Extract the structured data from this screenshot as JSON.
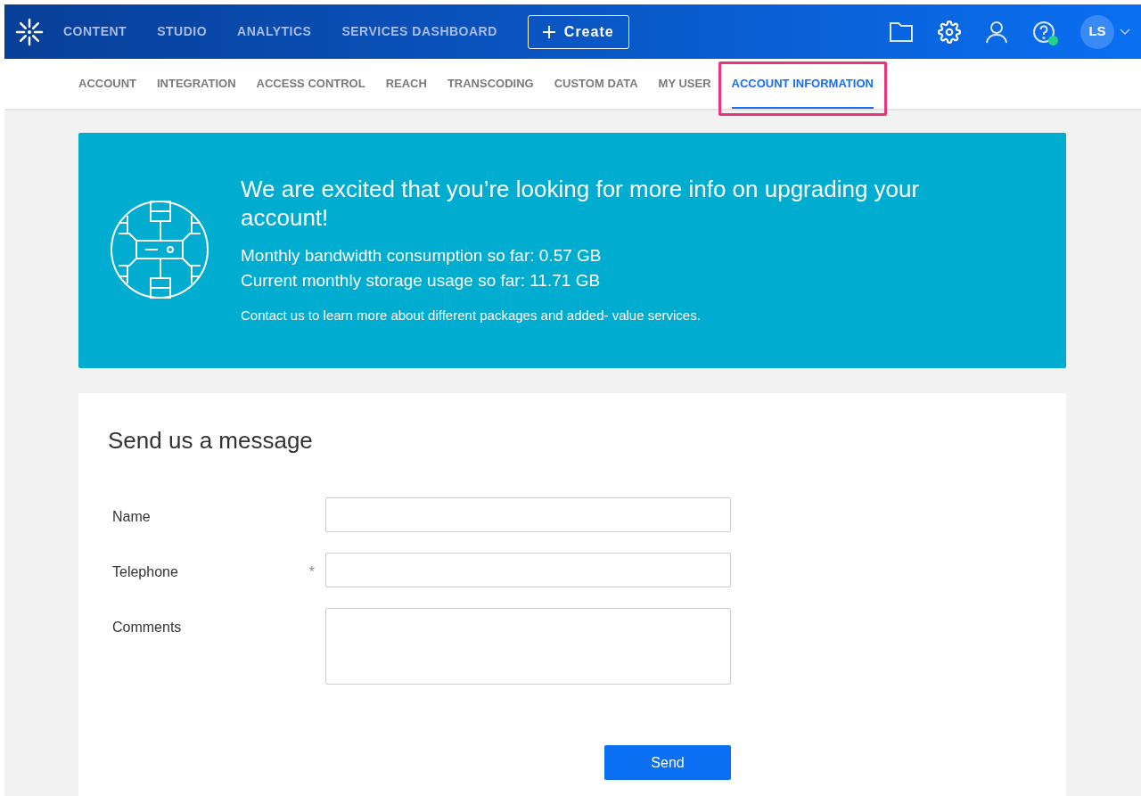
{
  "topbar": {
    "nav": [
      "CONTENT",
      "STUDIO",
      "ANALYTICS",
      "SERVICES DASHBOARD"
    ],
    "create_button": "Create",
    "avatar": "LS",
    "help_online": true
  },
  "tabs": [
    {
      "label": "ACCOUNT",
      "selected": false,
      "highlighted": false
    },
    {
      "label": "INTEGRATION",
      "selected": false,
      "highlighted": false
    },
    {
      "label": "ACCESS CONTROL",
      "selected": false,
      "highlighted": false
    },
    {
      "label": "REACH",
      "selected": false,
      "highlighted": false
    },
    {
      "label": "TRANSCODING",
      "selected": false,
      "highlighted": false
    },
    {
      "label": "CUSTOM DATA",
      "selected": false,
      "highlighted": false
    },
    {
      "label": "MY USER",
      "selected": false,
      "highlighted": false
    },
    {
      "label": "ACCOUNT INFORMATION",
      "selected": true,
      "highlighted": true
    }
  ],
  "banner": {
    "title": "We are excited that you’re looking for more info on upgrading your account!",
    "stats": [
      "Monthly bandwidth consumption so far: 0.57 GB",
      "Current monthly storage usage so far: 11.71 GB"
    ],
    "note": "Contact us to learn more about different packages and added- value services."
  },
  "form": {
    "title": "Send us a message",
    "fields": [
      {
        "label": "Name",
        "kind": "text"
      },
      {
        "label": "Telephone",
        "kind": "text",
        "required_mark": "*"
      },
      {
        "label": "Comments",
        "kind": "textarea"
      }
    ],
    "submit": "Send"
  }
}
